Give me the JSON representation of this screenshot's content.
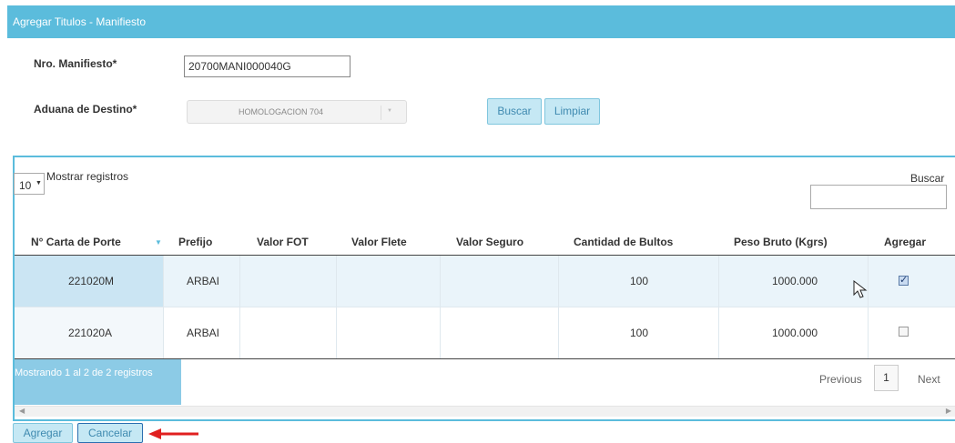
{
  "header": {
    "title": "Agregar Titulos - Manifiesto"
  },
  "form": {
    "manifest_label": "Nro. Manifiesto*",
    "manifest_value": "20700MANI000040G",
    "aduana_label": "Aduana de Destino*",
    "aduana_value": "HOMOLOGACION 704",
    "search_button": "Buscar",
    "clear_button": "Limpiar"
  },
  "table": {
    "length_value": "10",
    "length_label": "Mostrar registros",
    "search_label": "Buscar",
    "columns": [
      "N° Carta de Porte",
      "Prefijo",
      "Valor FOT",
      "Valor Flete",
      "Valor Seguro",
      "Cantidad de Bultos",
      "Peso Bruto (Kgrs)",
      "Agregar"
    ],
    "rows": [
      {
        "carta": "221020M",
        "prefijo": "ARBAI",
        "fot": "",
        "flete": "",
        "seguro": "",
        "bultos": "100",
        "peso": "1000.000",
        "agregar": true
      },
      {
        "carta": "221020A",
        "prefijo": "ARBAI",
        "fot": "",
        "flete": "",
        "seguro": "",
        "bultos": "100",
        "peso": "1000.000",
        "agregar": false
      }
    ],
    "info": "Mostrando 1 al 2 de 2 registros",
    "pagination": {
      "previous": "Previous",
      "page": "1",
      "next": "Next"
    }
  },
  "footer": {
    "add_button": "Agregar",
    "cancel_button": "Cancelar"
  },
  "colors": {
    "accent": "#5bbcdc",
    "button_bg": "#c5e8f4",
    "arrow": "#e02020"
  },
  "icons": {
    "sort": "sort-desc-icon",
    "dropdown": "caret-down-icon",
    "cursor": "mouse-pointer-icon",
    "annotation": "red-arrow-icon"
  }
}
